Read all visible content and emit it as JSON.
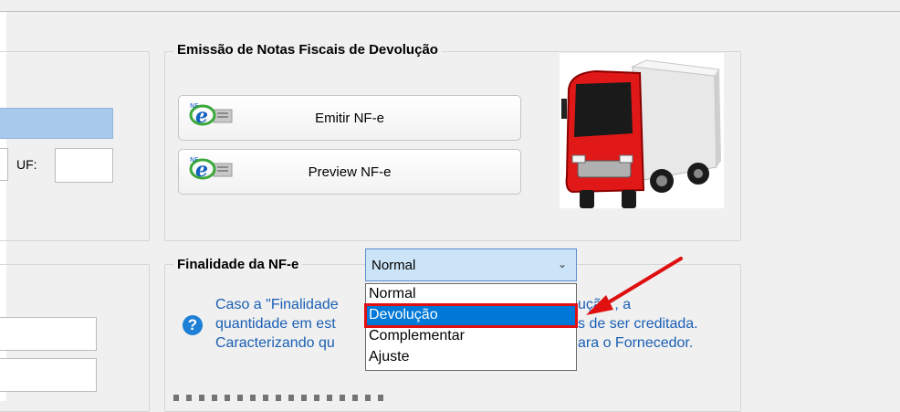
{
  "app": {
    "left_section": {
      "uf_label": "UF:"
    },
    "emissao": {
      "title": "Emissão de Notas Fiscais de Devolução",
      "emitir_label": "Emitir NF-e",
      "preview_label": "Preview NF-e",
      "icon_names": [
        "nfe-icon",
        "truck-icon"
      ]
    },
    "finalidade": {
      "title": "Finalidade da NF-e",
      "selected": "Normal",
      "options": [
        "Normal",
        "Devolução",
        "Complementar",
        "Ajuste"
      ],
      "highlighted_index": 1,
      "help_lines": [
        "Caso a \"Finalidade",
        "quantidade em est",
        "Caracterizando qu"
      ],
      "help_lines_right": [
        "ução\", a",
        "s de ser creditada.",
        "ara o Fornecedor."
      ]
    },
    "colors": {
      "highlight": "#0078d7",
      "annotation_red": "#e01010",
      "help_blue": "#1a5fb4"
    }
  }
}
